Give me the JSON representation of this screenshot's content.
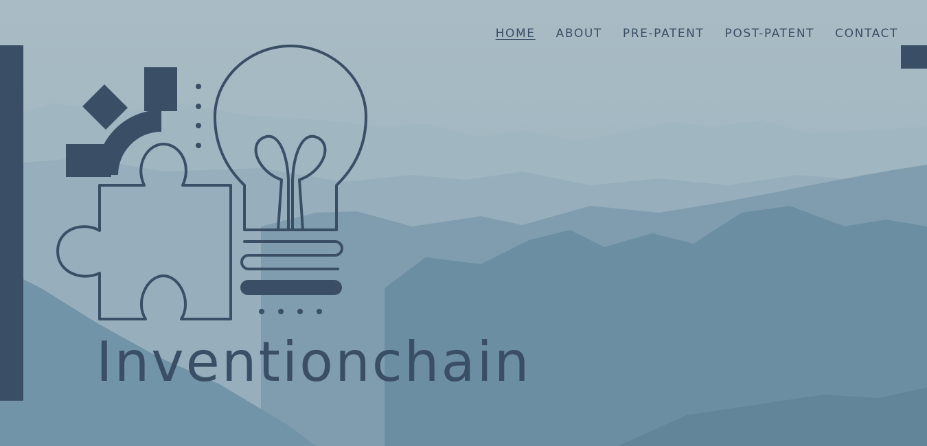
{
  "nav": {
    "items": [
      {
        "label": "HOME",
        "active": true
      },
      {
        "label": "ABOUT",
        "active": false
      },
      {
        "label": "PRE-PATENT",
        "active": false
      },
      {
        "label": "POST-PATENT",
        "active": false
      },
      {
        "label": "CONTACT",
        "active": false
      }
    ]
  },
  "hero": {
    "brand_name": "Inventionchain",
    "logo_icons": [
      "gear-icon",
      "puzzle-piece-icon",
      "lightbulb-icon"
    ],
    "background": "misty-mountains-image"
  },
  "colors": {
    "accent": "#3a4f66",
    "background": "#a4b8c2"
  }
}
